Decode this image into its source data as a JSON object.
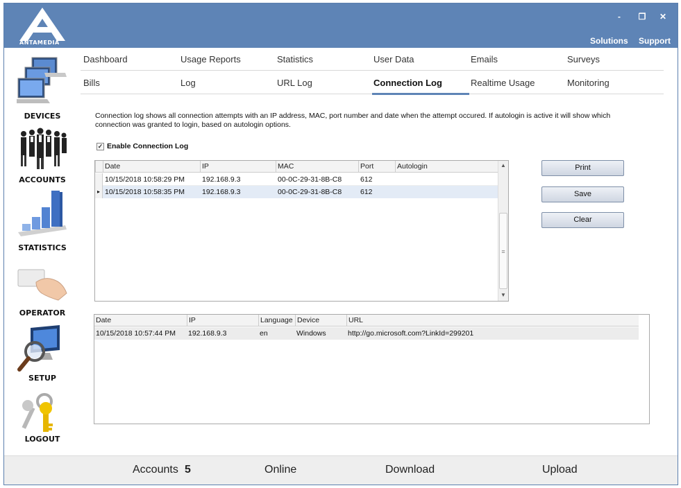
{
  "brand": {
    "logo_text": "ANTAMEDIA"
  },
  "window_controls": {
    "minimize": "-",
    "restore": "❐",
    "close": "✕"
  },
  "top_links": {
    "solutions": "Solutions",
    "support": "Support"
  },
  "sidebar": {
    "items": [
      {
        "label": "DEVICES",
        "icon": "computers-icon"
      },
      {
        "label": "ACCOUNTS",
        "icon": "people-icon"
      },
      {
        "label": "STATISTICS",
        "icon": "bar-chart-icon"
      },
      {
        "label": "OPERATOR",
        "icon": "hand-card-icon"
      },
      {
        "label": "SETUP",
        "icon": "monitor-magnifier-icon"
      },
      {
        "label": "LOGOUT",
        "icon": "keys-icon"
      }
    ]
  },
  "nav": {
    "row1": [
      "Dashboard",
      "Usage Reports",
      "Statistics",
      "User Data",
      "Emails",
      "Surveys"
    ],
    "row2": [
      "Bills",
      "Log",
      "URL Log",
      "Connection Log",
      "Realtime Usage",
      "Monitoring"
    ],
    "active": "Connection Log"
  },
  "content": {
    "description": "Connection log shows all connection attempts with an IP address, MAC, port number and date when the attempt occured. If autologin is active it will show which connection was granted to login, based on autologin options.",
    "enable_checkbox": {
      "label": "Enable Connection Log",
      "checked": true,
      "mark": "✓"
    }
  },
  "connection_grid": {
    "columns": [
      "Date",
      "IP",
      "MAC",
      "Port",
      "Autologin"
    ],
    "rows": [
      {
        "date": "10/15/2018 10:58:29 PM",
        "ip": "192.168.9.3",
        "mac": "00-0C-29-31-8B-C8",
        "port": "612",
        "autologin": ""
      },
      {
        "date": "10/15/2018 10:58:35 PM",
        "ip": "192.168.9.3",
        "mac": "00-0C-29-31-8B-C8",
        "port": "612",
        "autologin": ""
      }
    ]
  },
  "url_grid": {
    "columns": [
      "Date",
      "IP",
      "Language",
      "Device",
      "URL"
    ],
    "rows": [
      {
        "date": "10/15/2018 10:57:44 PM",
        "ip": "192.168.9.3",
        "language": "en",
        "device": "Windows",
        "url": "http://go.microsoft.com?LinkId=299201"
      }
    ]
  },
  "buttons": {
    "print": "Print",
    "save": "Save",
    "clear": "Clear"
  },
  "statusbar": {
    "accounts_label": "Accounts",
    "accounts_count": "5",
    "online_label": "Online",
    "download_label": "Download",
    "upload_label": "Upload"
  },
  "colors": {
    "titlebar": "#5e84b6",
    "active_tab_underline": "#5e84b6",
    "selected_row": "#e3ebf6"
  }
}
